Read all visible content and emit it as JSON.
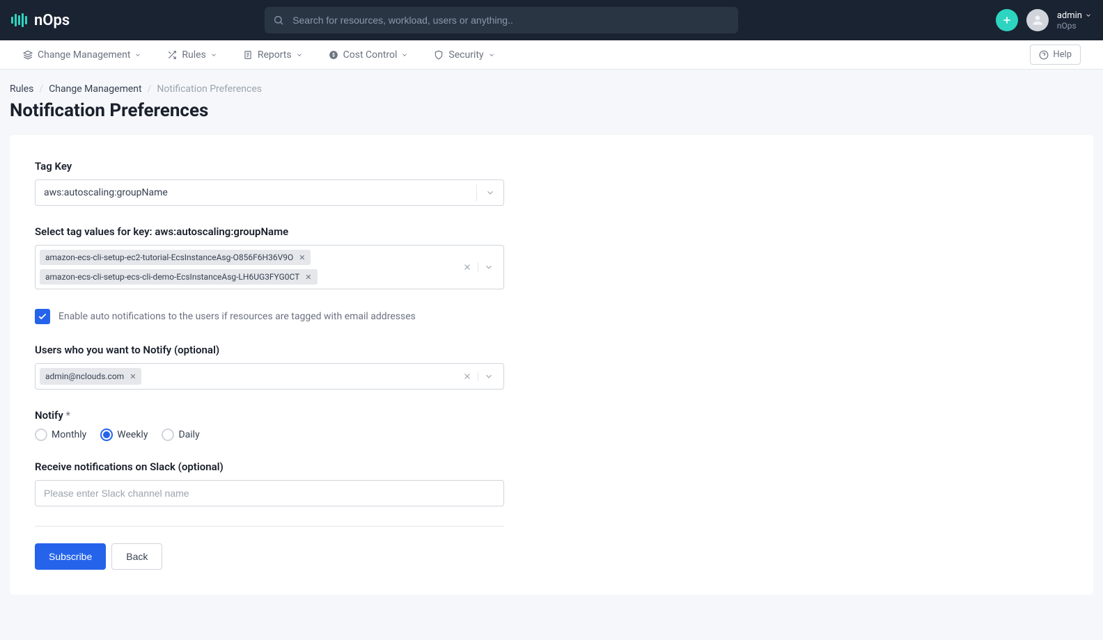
{
  "header": {
    "logo_text": "nOps",
    "search_placeholder": "Search for resources, workload, users or anything..",
    "user_name": "admin",
    "user_org": "nOps"
  },
  "nav": {
    "items": [
      {
        "label": "Change Management"
      },
      {
        "label": "Rules"
      },
      {
        "label": "Reports"
      },
      {
        "label": "Cost Control"
      },
      {
        "label": "Security"
      }
    ],
    "help": "Help"
  },
  "breadcrumb": {
    "items": [
      "Rules",
      "Change Management",
      "Notification Preferences"
    ]
  },
  "page": {
    "title": "Notification Preferences"
  },
  "form": {
    "tag_key": {
      "label": "Tag Key",
      "value": "aws:autoscaling:groupName"
    },
    "tag_values": {
      "label": "Select tag values for key: aws:autoscaling:groupName",
      "selected": [
        "amazon-ecs-cli-setup-ec2-tutorial-EcsInstanceAsg-O856F6H36V9O",
        "amazon-ecs-cli-setup-ecs-cli-demo-EcsInstanceAsg-LH6UG3FYG0CT"
      ]
    },
    "auto_notify": {
      "checked": true,
      "label": "Enable auto notifications to the users if resources are tagged with email addresses"
    },
    "users": {
      "label": "Users who you want to Notify (optional)",
      "selected": [
        "admin@nclouds.com"
      ]
    },
    "notify_frequency": {
      "label": "Notify ",
      "asterisk": "*",
      "options": [
        "Monthly",
        "Weekly",
        "Daily"
      ],
      "selected": "Weekly"
    },
    "slack": {
      "label": "Receive notifications on Slack (optional)",
      "placeholder": "Please enter Slack channel name"
    },
    "subscribe_btn": "Subscribe",
    "back_btn": "Back"
  }
}
